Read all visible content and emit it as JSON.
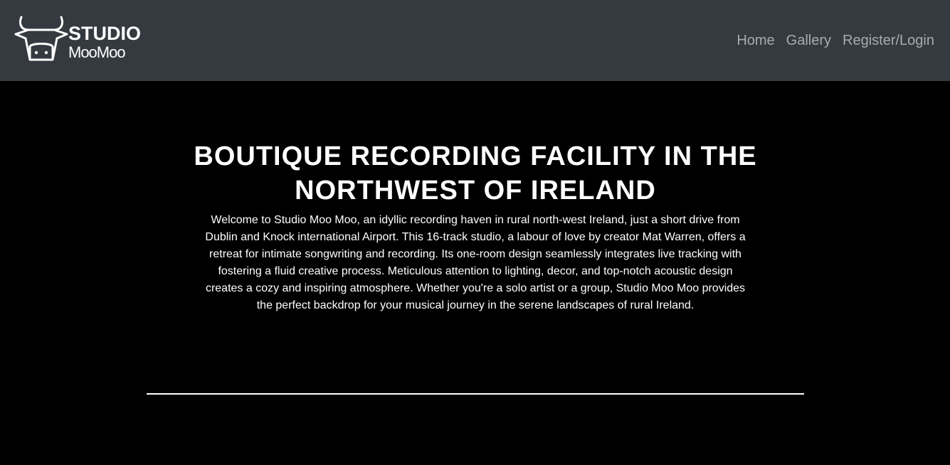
{
  "colors": {
    "navbar_bg": "#343a40",
    "nav_link": "#a9abae",
    "page_bg": "#000000",
    "text": "#ffffff"
  },
  "brand": {
    "logo_icon": "cow-head-icon",
    "line1": "STUDIO",
    "line2": "MooMoo"
  },
  "nav": {
    "items": [
      {
        "label": "Home"
      },
      {
        "label": "Gallery"
      },
      {
        "label": "Register/Login"
      }
    ]
  },
  "hero": {
    "title": "BOUTIQUE RECORDING FACILITY IN THE NORTHWEST OF IRELAND",
    "description": "Welcome to Studio Moo Moo, an idyllic recording haven in rural north-west Ireland, just a short drive from Dublin and Knock international Airport. This 16-track studio, a labour of love by creator Mat Warren, offers a retreat for intimate songwriting and recording. Its one-room design seamlessly integrates live tracking with fostering a fluid creative process. Meticulous attention to lighting, decor, and top-notch acoustic design creates a cozy and inspiring atmosphere. Whether you're a solo artist or a group, Studio Moo Moo provides the perfect backdrop for your musical journey in the serene landscapes of rural Ireland."
  }
}
